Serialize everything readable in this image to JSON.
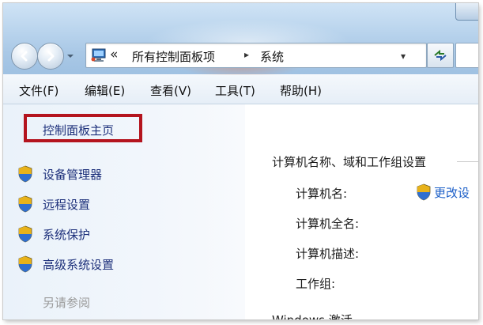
{
  "nav": {
    "address_chevron": "«",
    "breadcrumbs": [
      "所有控制面板项",
      "系统"
    ],
    "separator": "▸",
    "dropdown_glyph": "▾"
  },
  "menu": {
    "items": [
      "文件(F)",
      "编辑(E)",
      "查看(V)",
      "工具(T)",
      "帮助(H)"
    ]
  },
  "sidebar": {
    "home_link": "控制面板主页",
    "tasks": [
      "设备管理器",
      "远程设置",
      "系统保护",
      "高级系统设置"
    ],
    "see_also": "另请参阅"
  },
  "main": {
    "section_title": "计算机名称、域和工作组设置",
    "fields": [
      "计算机名:",
      "计算机全名:",
      "计算机描述:",
      "工作组:"
    ],
    "change_settings": "更改设",
    "cut_off_text": "Windows 激活"
  },
  "colors": {
    "highlight_border": "#b4141e",
    "link": "#1c2f7a",
    "change_link": "#1c5fc8",
    "see_also": "#9a9a9a"
  }
}
